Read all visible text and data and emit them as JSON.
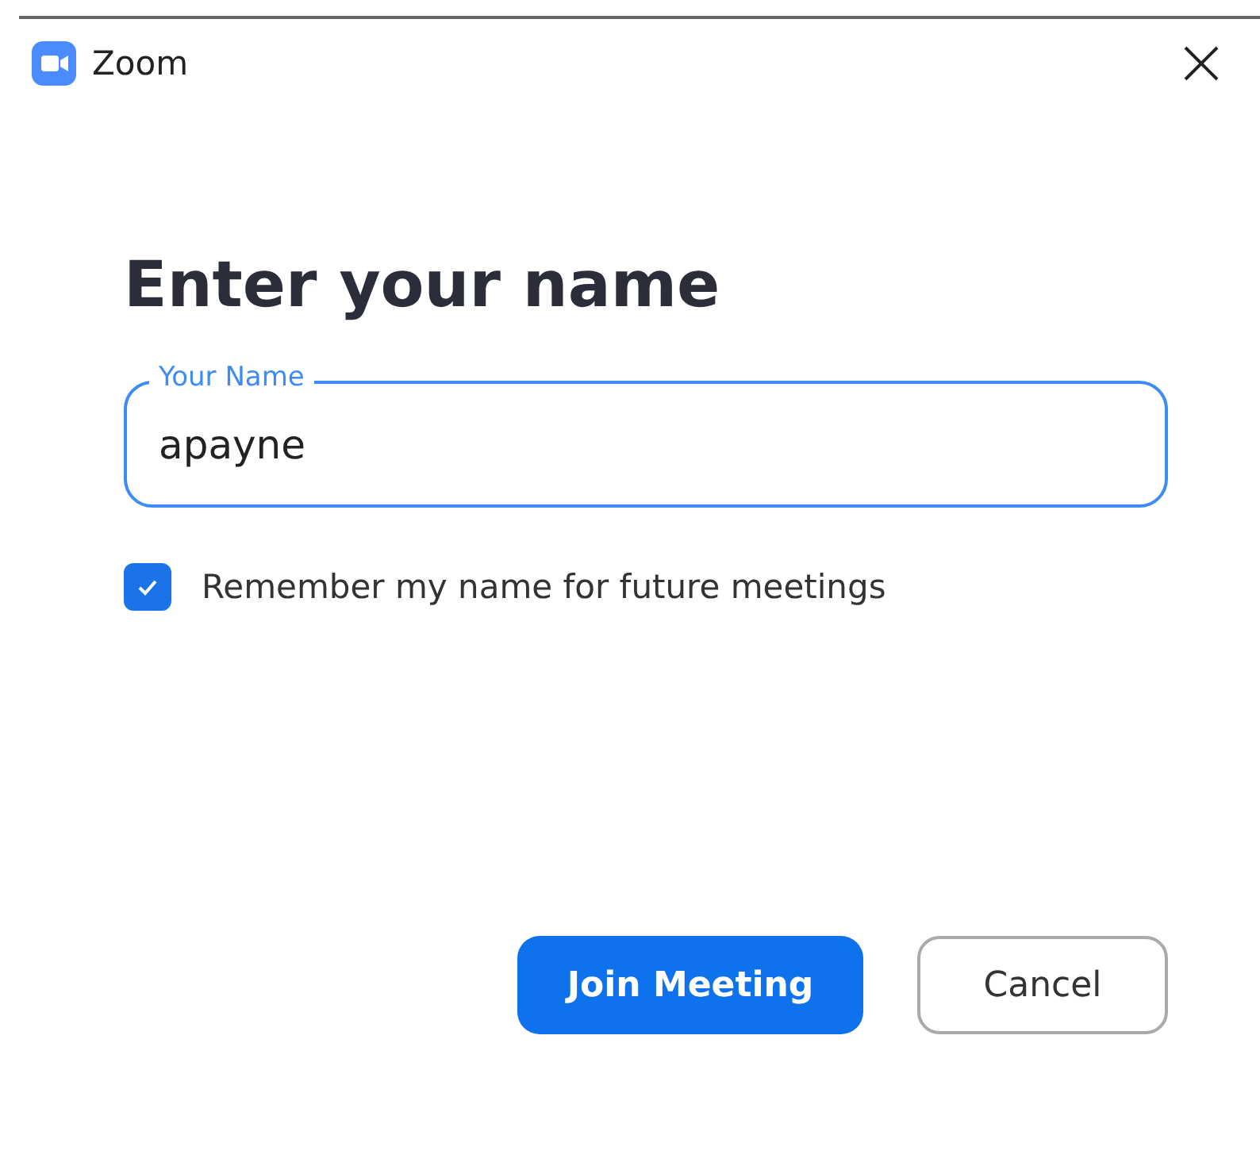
{
  "window": {
    "title": "Zoom"
  },
  "heading": "Enter your name",
  "name_field": {
    "label": "Your Name",
    "value": "apayne"
  },
  "remember": {
    "label": "Remember my name for future meetings",
    "checked": true
  },
  "buttons": [
    {
      "label": "Join Meeting",
      "kind": "primary"
    },
    {
      "label": "Cancel",
      "kind": "secondary"
    }
  ]
}
